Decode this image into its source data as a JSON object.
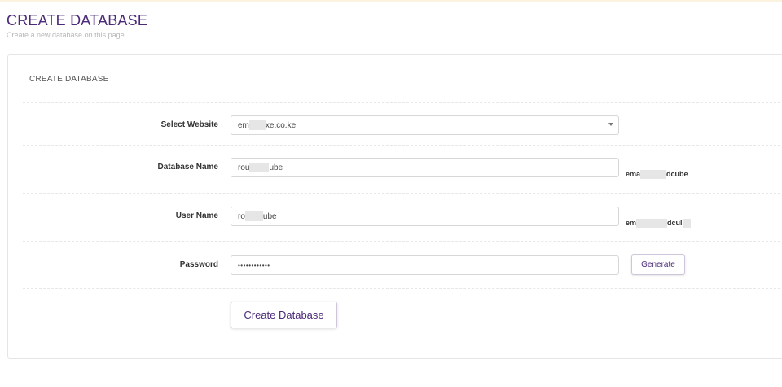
{
  "header": {
    "title": "CREATE DATABASE",
    "subtitle": "Create a new database on this page."
  },
  "card": {
    "title": "CREATE DATABASE"
  },
  "form": {
    "website": {
      "label": "Select Website",
      "value_start": "em",
      "value_end": "xe.co.ke"
    },
    "database_name": {
      "label": "Database Name",
      "value_start": "rou",
      "value_end": "ube",
      "suffix_start": "ema",
      "suffix_end": "dcube"
    },
    "user_name": {
      "label": "User Name",
      "value_start": "ro",
      "value_end": "ube",
      "suffix_start": "em",
      "suffix_end": "dcul"
    },
    "password": {
      "label": "Password",
      "value": "••••••••••••",
      "generate_label": "Generate"
    },
    "submit_label": "Create Database"
  }
}
